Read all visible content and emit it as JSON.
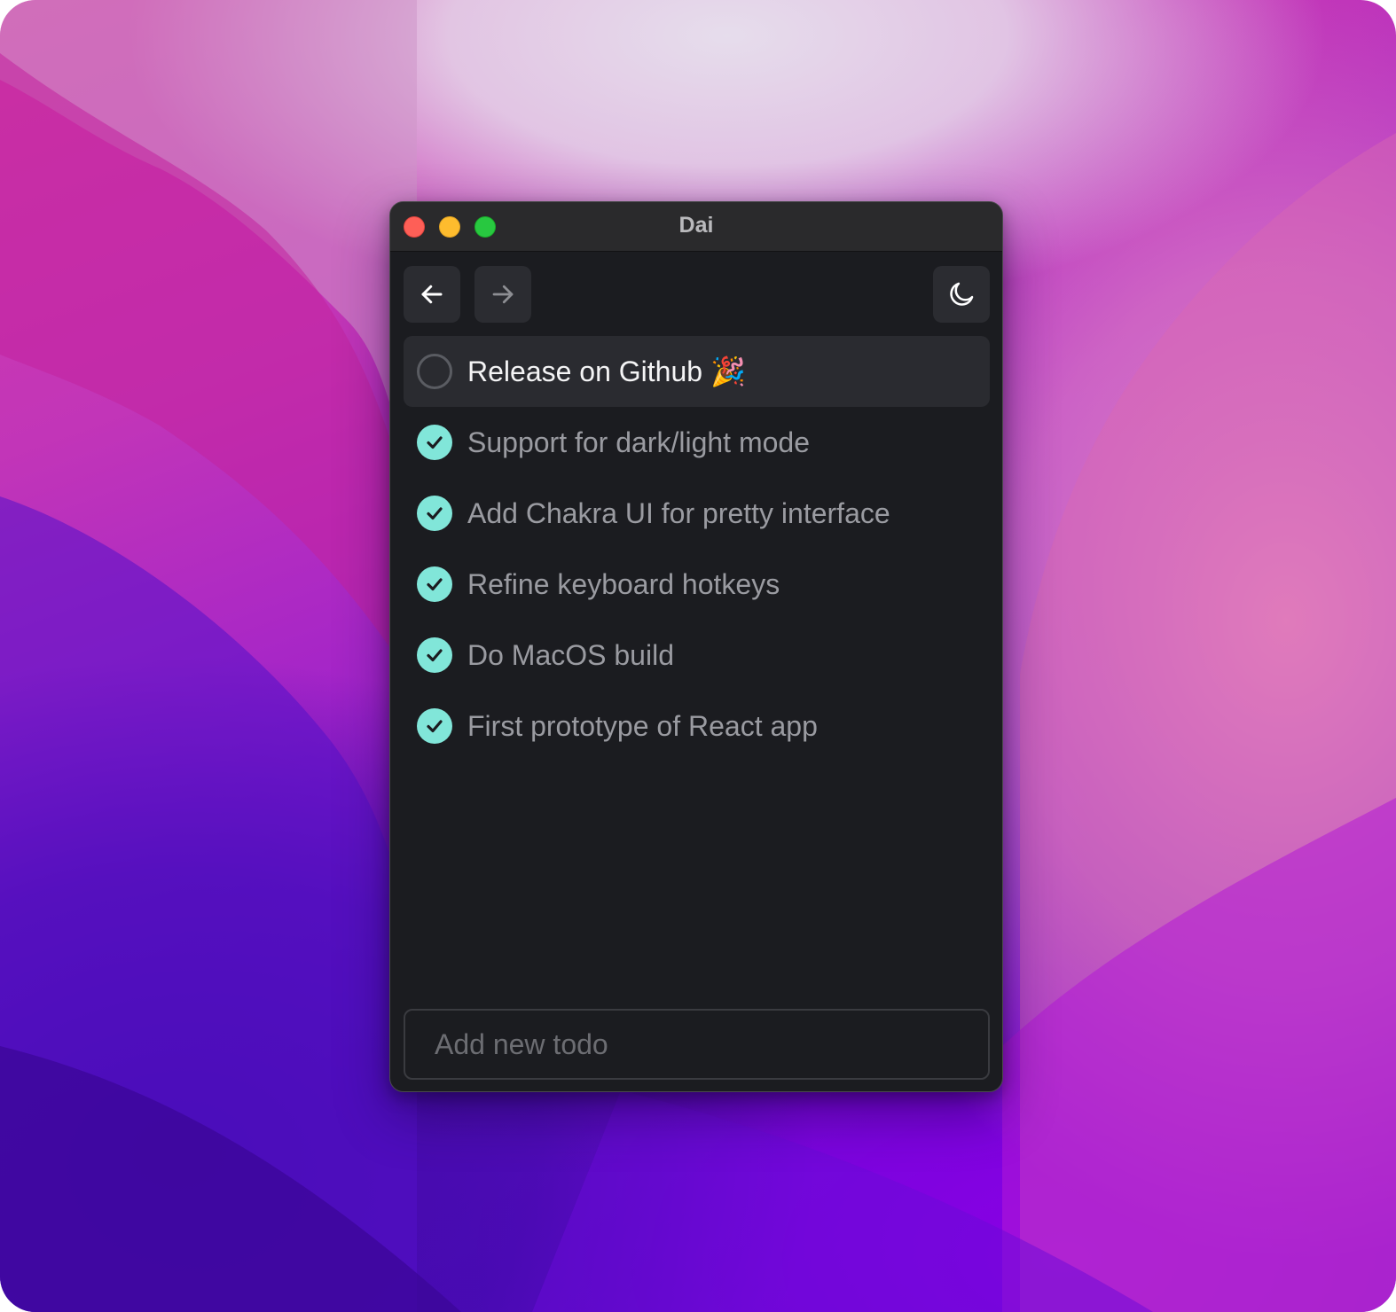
{
  "window": {
    "title": "Dai"
  },
  "toolbar": {
    "back_icon": "arrow-left-icon",
    "forward_icon": "arrow-right-icon",
    "theme_icon": "moon-icon"
  },
  "todos": [
    {
      "text": "Release on Github 🎉",
      "done": false,
      "selected": true
    },
    {
      "text": "Support for dark/light mode",
      "done": true,
      "selected": false
    },
    {
      "text": "Add Chakra UI for pretty interface",
      "done": true,
      "selected": false
    },
    {
      "text": "Refine keyboard hotkeys",
      "done": true,
      "selected": false
    },
    {
      "text": "Do MacOS build",
      "done": true,
      "selected": false
    },
    {
      "text": "First prototype of React app",
      "done": true,
      "selected": false
    }
  ],
  "new_todo": {
    "placeholder": "Add new todo",
    "value": ""
  },
  "colors": {
    "accent": "#81e6d9",
    "window_bg": "#1b1c20",
    "titlebar_bg": "#2a2a2c"
  }
}
